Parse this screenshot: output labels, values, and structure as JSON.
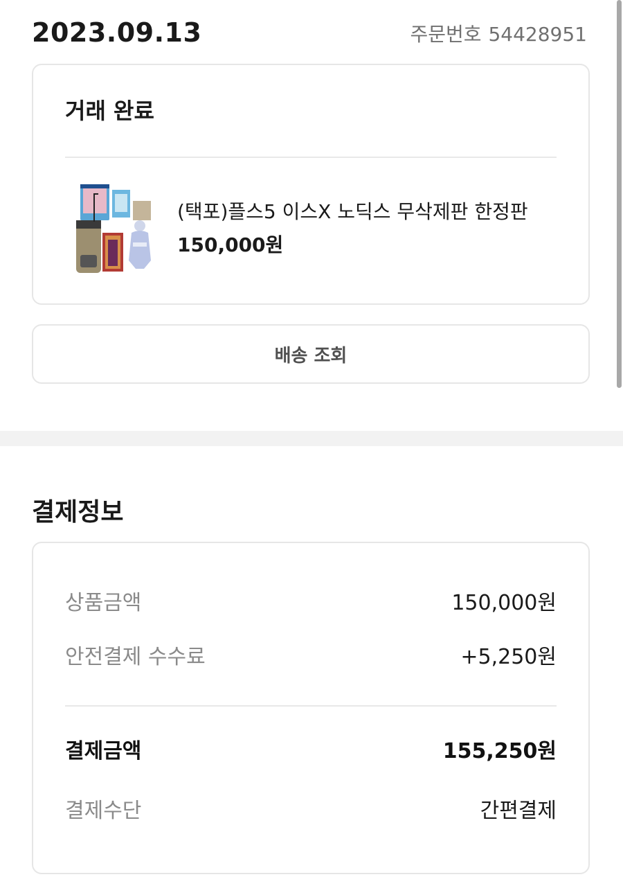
{
  "header": {
    "date": "2023.09.13",
    "order_label": "주문번호",
    "order_number": "54428951"
  },
  "order": {
    "status": "거래 완료",
    "product": {
      "name": "(택포)플스5 이스X 노딕스 무삭제판 한정판",
      "price": "150,000원",
      "thumbnail_icon": "product-bundle-image"
    }
  },
  "delivery_button": {
    "label": "배송 조회"
  },
  "payment": {
    "section_title": "결제정보",
    "rows": [
      {
        "label": "상품금액",
        "value": "150,000원"
      },
      {
        "label": "안전결제 수수료",
        "value": "+5,250원"
      }
    ],
    "total": {
      "label": "결제금액",
      "value": "155,250원"
    },
    "method": {
      "label": "결제수단",
      "value": "간편결제"
    }
  },
  "colors": {
    "border": "#e6e6e6",
    "muted_text": "#8a8a8a",
    "section_gap": "#f2f2f2"
  }
}
